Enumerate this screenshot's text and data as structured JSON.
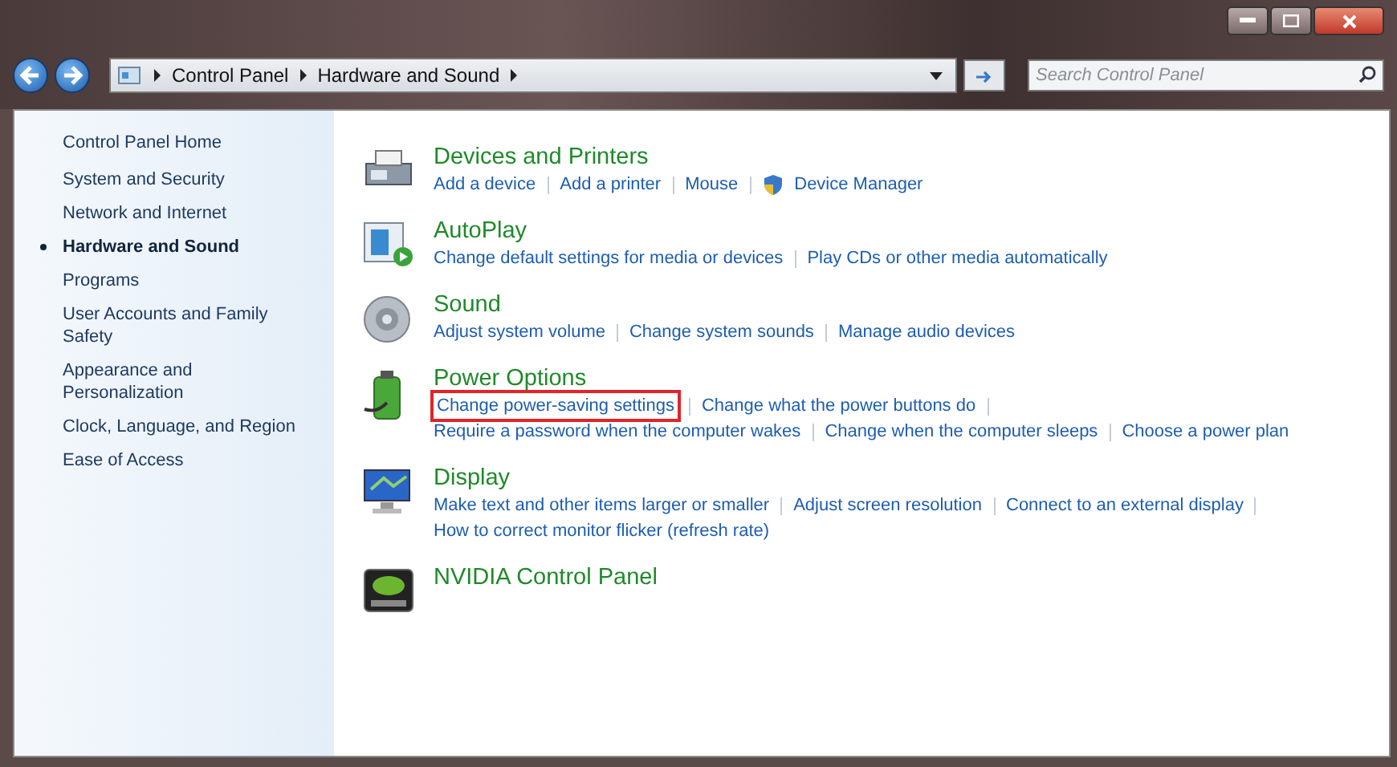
{
  "address_bar": {
    "crumbs": [
      "Control Panel",
      "Hardware and Sound"
    ]
  },
  "search": {
    "placeholder": "Search Control Panel"
  },
  "sidebar": {
    "home": "Control Panel Home",
    "items": [
      {
        "label": "System and Security",
        "selected": false
      },
      {
        "label": "Network and Internet",
        "selected": false
      },
      {
        "label": "Hardware and Sound",
        "selected": true
      },
      {
        "label": "Programs",
        "selected": false
      },
      {
        "label": "User Accounts and Family Safety",
        "selected": false
      },
      {
        "label": "Appearance and Personalization",
        "selected": false
      },
      {
        "label": "Clock, Language, and Region",
        "selected": false
      },
      {
        "label": "Ease of Access",
        "selected": false
      }
    ]
  },
  "categories": [
    {
      "kind": "devices",
      "title": "Devices and Printers",
      "lines": [
        {
          "links": [
            {
              "label": "Add a device"
            },
            {
              "label": "Add a printer"
            },
            {
              "label": "Mouse"
            },
            {
              "label": "Device Manager",
              "shield": true
            }
          ]
        }
      ]
    },
    {
      "kind": "autoplay",
      "title": "AutoPlay",
      "lines": [
        {
          "links": [
            {
              "label": "Change default settings for media or devices"
            },
            {
              "label": "Play CDs or other media automatically"
            }
          ]
        }
      ]
    },
    {
      "kind": "sound",
      "title": "Sound",
      "lines": [
        {
          "links": [
            {
              "label": "Adjust system volume"
            },
            {
              "label": "Change system sounds"
            },
            {
              "label": "Manage audio devices"
            }
          ]
        }
      ]
    },
    {
      "kind": "power",
      "title": "Power Options",
      "lines": [
        {
          "links": [
            {
              "label": "Change power-saving settings",
              "highlighted": true
            },
            {
              "label": "Change what the power buttons do"
            }
          ],
          "trailing_separator": true
        },
        {
          "links": [
            {
              "label": "Require a password when the computer wakes"
            },
            {
              "label": "Change when the computer sleeps"
            },
            {
              "label": "Choose a power plan"
            }
          ]
        }
      ]
    },
    {
      "kind": "display",
      "title": "Display",
      "lines": [
        {
          "links": [
            {
              "label": "Make text and other items larger or smaller"
            },
            {
              "label": "Adjust screen resolution"
            },
            {
              "label": "Connect to an external display"
            }
          ],
          "trailing_separator": true
        },
        {
          "links": [
            {
              "label": "How to correct monitor flicker (refresh rate)"
            }
          ]
        }
      ]
    },
    {
      "kind": "nvidia",
      "title": "NVIDIA Control Panel"
    }
  ]
}
